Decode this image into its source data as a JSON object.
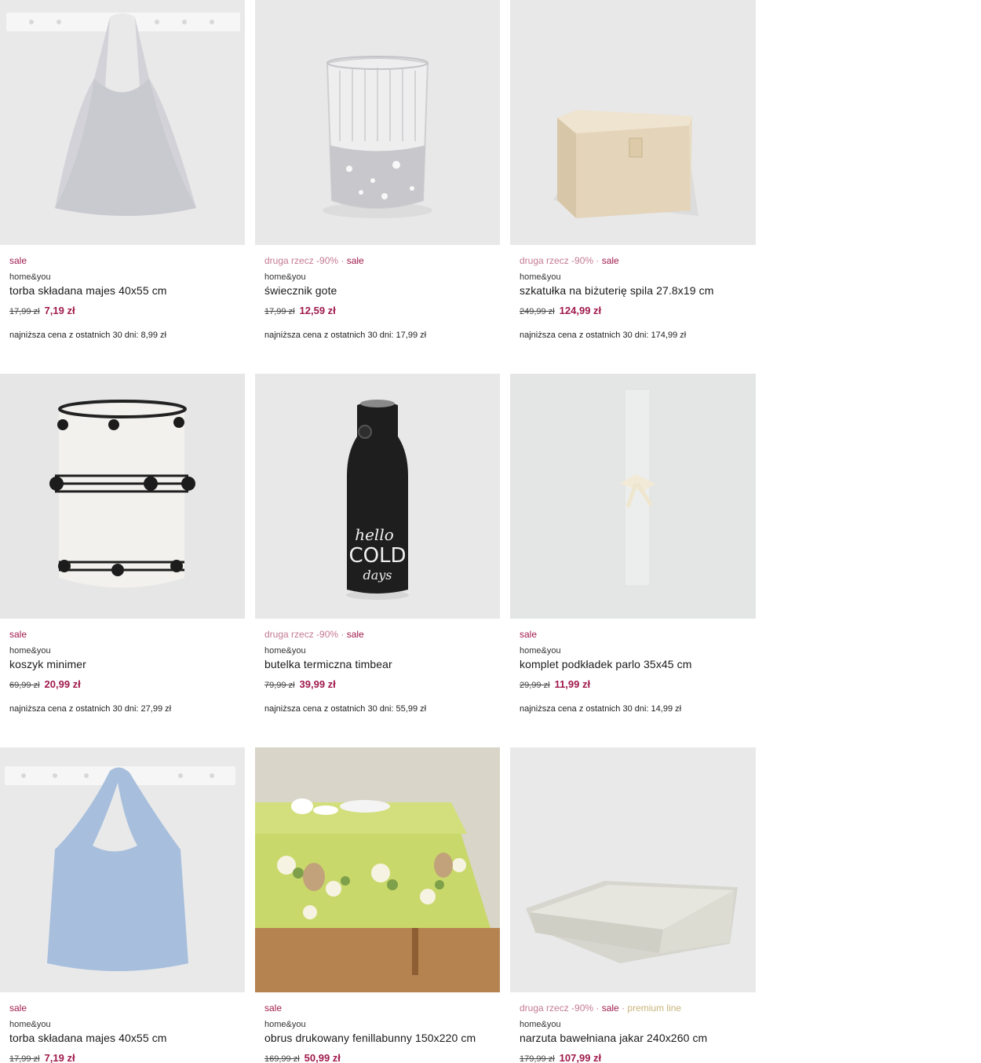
{
  "colors": {
    "accent": "#a01a4c",
    "promo": "#c47a93",
    "premium": "#c9b37a"
  },
  "products": [
    {
      "tags": {
        "promo": "",
        "sep1": "",
        "sale": "sale",
        "sep2": "",
        "premium": ""
      },
      "image_icon": "gray-tote-bag-on-hook-image",
      "brand": "home&you",
      "name": "torba składana majes 40x55 cm",
      "old_price": "17,99 zł",
      "new_price": "7,19 zł",
      "lowest": "najniższa cena z ostatnich 30 dni: 8,99 zł"
    },
    {
      "tags": {
        "promo": "druga rzecz -90%",
        "sep1": " · ",
        "sale": "sale",
        "sep2": "",
        "premium": ""
      },
      "image_icon": "glass-candle-holder-image",
      "brand": "home&you",
      "name": "świecznik gote",
      "old_price": "17,99 zł",
      "new_price": "12,59 zł",
      "lowest": "najniższa cena z ostatnich 30 dni: 17,99 zł"
    },
    {
      "tags": {
        "promo": "druga rzecz -90%",
        "sep1": " · ",
        "sale": "sale",
        "sep2": "",
        "premium": ""
      },
      "image_icon": "jewelry-box-image",
      "brand": "home&you",
      "name": "szkatułka na biżuterię spila 27.8x19 cm",
      "old_price": "249,99 zł",
      "new_price": "124,99 zł",
      "lowest": "najniższa cena z ostatnich 30 dni: 174,99 zł"
    },
    {
      "tags": {
        "promo": "",
        "sep1": "",
        "sale": "sale",
        "sep2": "",
        "premium": ""
      },
      "image_icon": "woven-basket-image",
      "brand": "home&you",
      "name": "koszyk minimer",
      "old_price": "69,99 zł",
      "new_price": "20,99 zł",
      "lowest": "najniższa cena z ostatnich 30 dni: 27,99 zł"
    },
    {
      "tags": {
        "promo": "druga rzecz -90%",
        "sep1": " · ",
        "sale": "sale",
        "sep2": "",
        "premium": ""
      },
      "image_icon": "thermal-bottle-image",
      "bottle_text": {
        "line1": "hello",
        "line2": "COLD",
        "line3": "days"
      },
      "brand": "home&you",
      "name": "butelka termiczna timbear",
      "old_price": "79,99 zł",
      "new_price": "39,99 zł",
      "lowest": "najniższa cena z ostatnich 30 dni: 55,99 zł"
    },
    {
      "tags": {
        "promo": "",
        "sep1": "",
        "sale": "sale",
        "sep2": "",
        "premium": ""
      },
      "image_icon": "placemat-set-image",
      "brand": "home&you",
      "name": "komplet podkładek parlo 35x45 cm",
      "old_price": "29,99 zł",
      "new_price": "11,99 zł",
      "lowest": "najniższa cena z ostatnich 30 dni: 14,99 zł"
    },
    {
      "tags": {
        "promo": "",
        "sep1": "",
        "sale": "sale",
        "sep2": "",
        "premium": ""
      },
      "image_icon": "blue-tote-bag-on-hook-image",
      "brand": "home&you",
      "name": "torba składana majes 40x55 cm",
      "old_price": "17,99 zł",
      "new_price": "7,19 zł",
      "lowest": ""
    },
    {
      "tags": {
        "promo": "",
        "sep1": "",
        "sale": "sale",
        "sep2": "",
        "premium": ""
      },
      "image_icon": "easter-tablecloth-image",
      "brand": "home&you",
      "name": "obrus drukowany fenillabunny 150x220 cm",
      "old_price": "169,99 zł",
      "new_price": "50,99 zł",
      "lowest": ""
    },
    {
      "tags": {
        "promo": "druga rzecz -90%",
        "sep1": " · ",
        "sale": "sale",
        "sep2": " · ",
        "premium": "premium line"
      },
      "image_icon": "folded-bedspread-image",
      "brand": "home&you",
      "name": "narzuta bawełniana jakar 240x260 cm",
      "old_price": "179,99 zł",
      "new_price": "107,99 zł",
      "lowest": ""
    }
  ]
}
